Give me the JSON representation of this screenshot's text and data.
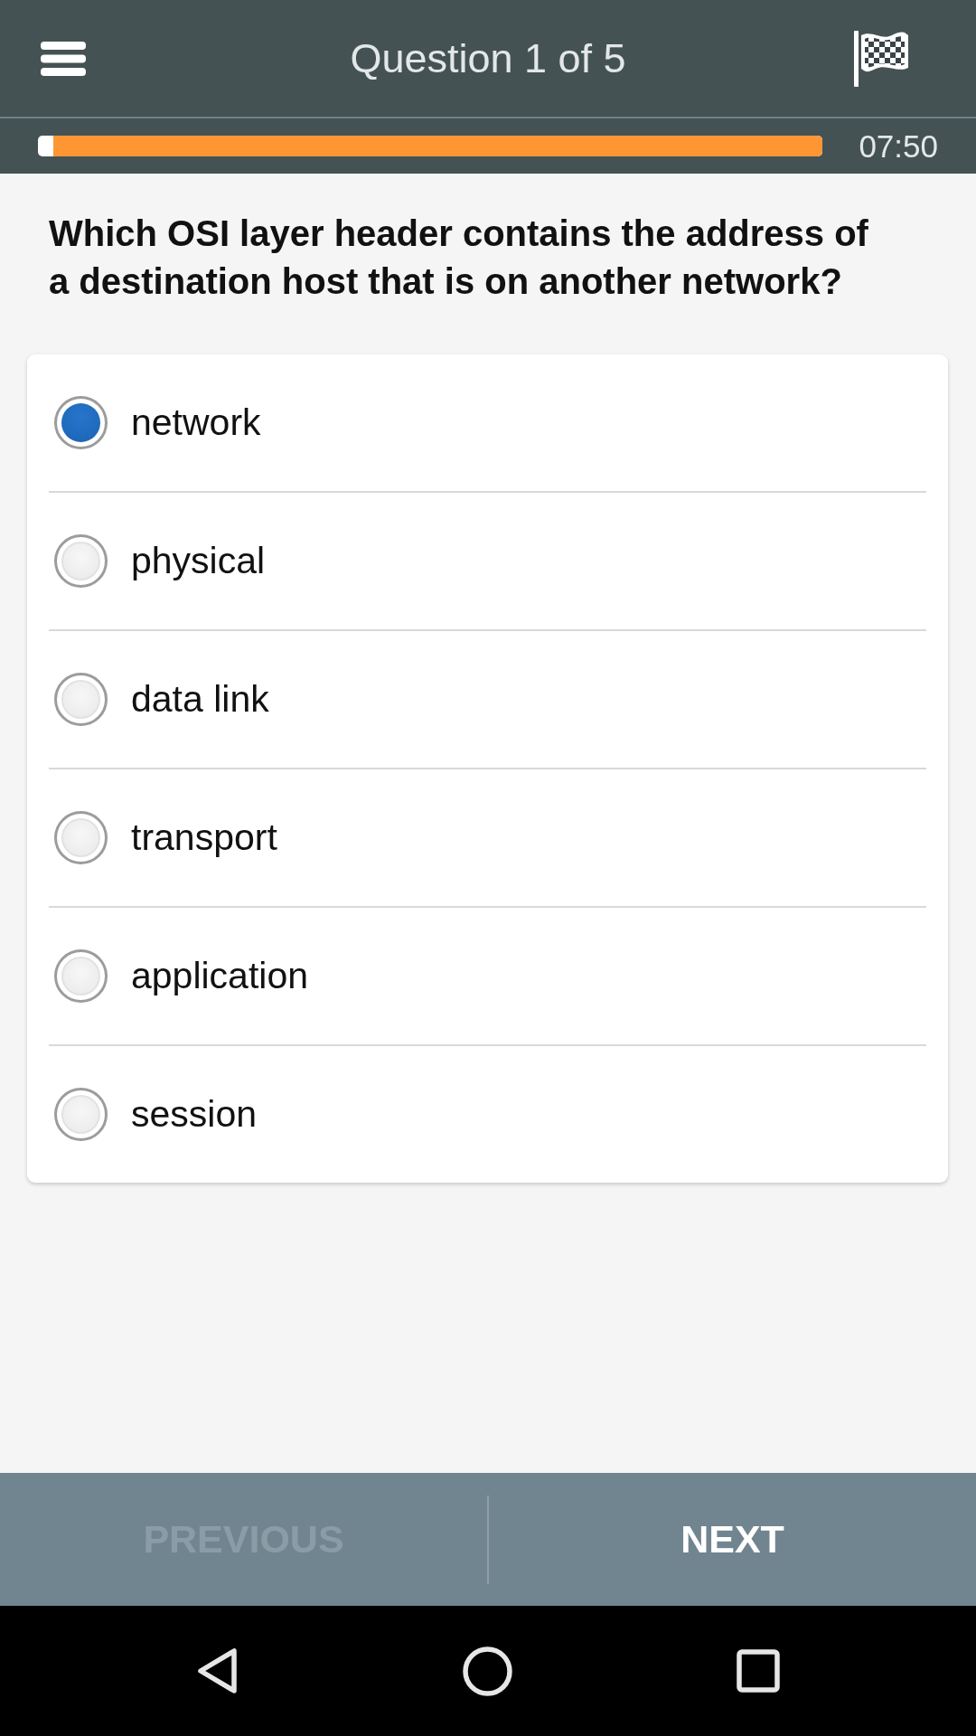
{
  "header": {
    "title": "Question 1 of 5"
  },
  "timer": {
    "level": 0.98,
    "reading": "07:50"
  },
  "question": "Which OSI layer header contains the address of a destination host that is on another network?",
  "options": [
    {
      "label": "network",
      "selected": true
    },
    {
      "label": "physical",
      "selected": false
    },
    {
      "label": "data link",
      "selected": false
    },
    {
      "label": "transport",
      "selected": false
    },
    {
      "label": "application",
      "selected": false
    },
    {
      "label": "session",
      "selected": false
    }
  ],
  "footer": {
    "buttons": [
      {
        "label": "PREVIOUS",
        "disabled": true
      },
      {
        "label": "NEXT",
        "disabled": false
      }
    ]
  }
}
